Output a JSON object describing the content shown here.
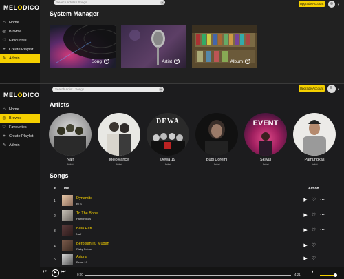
{
  "app": {
    "logo_pre": "MEL",
    "logo_o": "O",
    "logo_post": "DICO"
  },
  "frame_a": {
    "search_placeholder": "Search Artists / Songs",
    "upgrade": "Upgrade Account",
    "nav": [
      {
        "label": "Home",
        "icon": "home-icon",
        "glyph": "⌂"
      },
      {
        "label": "Browse",
        "icon": "globe-icon",
        "glyph": "◎"
      },
      {
        "label": "Favourites",
        "icon": "heart-icon",
        "glyph": "♡"
      },
      {
        "label": "Create Playlist",
        "icon": "plus-icon",
        "glyph": "+"
      },
      {
        "label": "Admin",
        "icon": "wrench-icon",
        "glyph": "✎"
      }
    ],
    "title": "System Manager",
    "tiles": [
      {
        "label": "Song",
        "plus": "+"
      },
      {
        "label": "Artist",
        "plus": "+"
      },
      {
        "label": "Album",
        "plus": "+"
      }
    ]
  },
  "frame_b": {
    "search_placeholder": "Search Artist / Songs",
    "upgrade": "Upgrade Account",
    "nav": [
      {
        "label": "Home",
        "icon": "home-icon",
        "glyph": "⌂"
      },
      {
        "label": "Browse",
        "icon": "globe-icon",
        "glyph": "◎"
      },
      {
        "label": "Favourites",
        "icon": "heart-icon",
        "glyph": "♡"
      },
      {
        "label": "Create Playlist",
        "icon": "plus-icon",
        "glyph": "+"
      },
      {
        "label": "Admin",
        "icon": "wrench-icon",
        "glyph": "✎"
      }
    ],
    "artists_title": "Artists",
    "artists": [
      {
        "name": "Naif",
        "role": "Artist"
      },
      {
        "name": "MeloMance",
        "role": "Artist"
      },
      {
        "name": "Dewa 19",
        "role": "Artist",
        "badge": "DEWA"
      },
      {
        "name": "Budi Doremi",
        "role": "Artist"
      },
      {
        "name": "Skilvul",
        "role": "Artist",
        "badge": "EVENT"
      },
      {
        "name": "Pamungkas",
        "role": "Artist"
      }
    ],
    "songs_title": "Songs",
    "col_num": "#",
    "col_title": "Title",
    "col_action": "Action",
    "songs": [
      {
        "num": "1",
        "title": "Dynamite",
        "artist": "BTS"
      },
      {
        "num": "2",
        "title": "To The Bone",
        "artist": "Pamungkas"
      },
      {
        "num": "3",
        "title": "Bula Hati",
        "artist": "Naif"
      },
      {
        "num": "4",
        "title": "Berpisah Itu Mudah",
        "artist": "Rizky Febian"
      },
      {
        "num": "5",
        "title": "Arjuna",
        "artist": "Dewa 19"
      }
    ],
    "player": {
      "current": "0:00",
      "duration": "4:21",
      "progress": 0.0,
      "volume": 0.9
    }
  },
  "colors": {
    "accent": "#f5d000",
    "bg": "#1c1c1e",
    "sidebar": "#161616"
  }
}
